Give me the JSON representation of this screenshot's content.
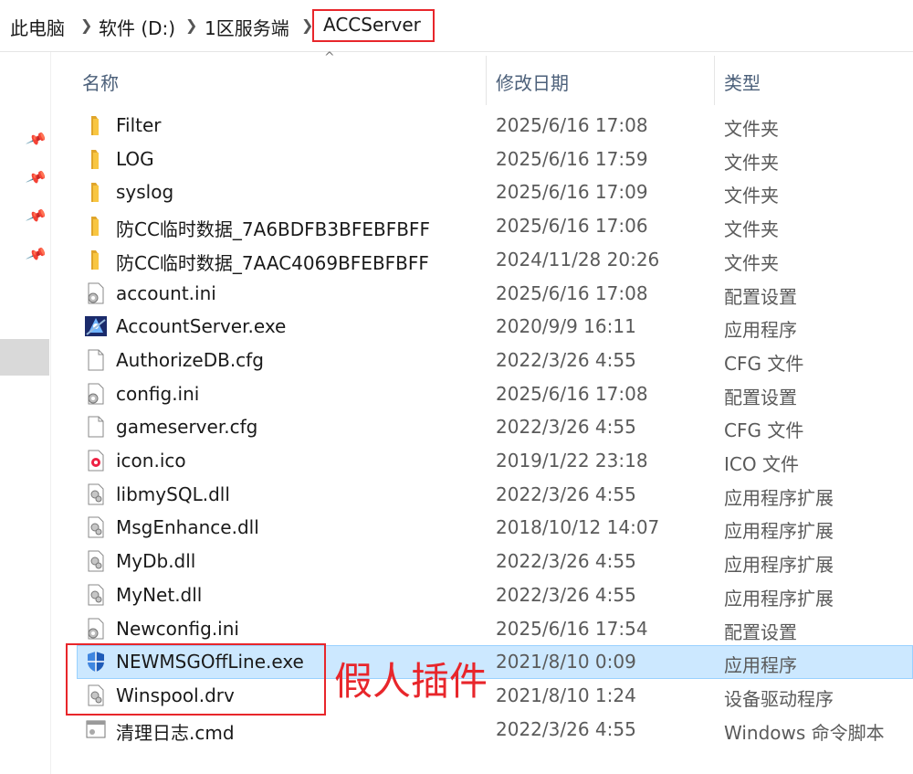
{
  "breadcrumb": {
    "items": [
      "此电脑",
      "软件 (D:)",
      "1区服务端",
      "ACCServer"
    ],
    "separator": ">"
  },
  "columns": {
    "sort_indicator": "^",
    "name": "名称",
    "date": "修改日期",
    "type": "类型"
  },
  "files": [
    {
      "name": "Filter",
      "date": "2025/6/16 17:08",
      "type": "文件夹",
      "icon": "folder-icon"
    },
    {
      "name": "LOG",
      "date": "2025/6/16 17:59",
      "type": "文件夹",
      "icon": "folder-icon"
    },
    {
      "name": "syslog",
      "date": "2025/6/16 17:09",
      "type": "文件夹",
      "icon": "folder-icon"
    },
    {
      "name": "防CC临时数据_7A6BDFB3BFEBFBFF",
      "date": "2025/6/16 17:06",
      "type": "文件夹",
      "icon": "folder-icon"
    },
    {
      "name": "防CC临时数据_7AAC4069BFEBFBFF",
      "date": "2024/11/28 20:26",
      "type": "文件夹",
      "icon": "folder-icon"
    },
    {
      "name": "account.ini",
      "date": "2025/6/16 17:08",
      "type": "配置设置",
      "icon": "ini-file-icon"
    },
    {
      "name": "AccountServer.exe",
      "date": "2020/9/9 16:11",
      "type": "应用程序",
      "icon": "exe-app-icon"
    },
    {
      "name": "AuthorizeDB.cfg",
      "date": "2022/3/26 4:55",
      "type": "CFG 文件",
      "icon": "blank-file-icon"
    },
    {
      "name": "config.ini",
      "date": "2025/6/16 17:08",
      "type": "配置设置",
      "icon": "ini-file-icon"
    },
    {
      "name": "gameserver.cfg",
      "date": "2022/3/26 4:55",
      "type": "CFG 文件",
      "icon": "blank-file-icon"
    },
    {
      "name": "icon.ico",
      "date": "2019/1/22 23:18",
      "type": "ICO 文件",
      "icon": "ico-file-icon"
    },
    {
      "name": "libmySQL.dll",
      "date": "2022/3/26 4:55",
      "type": "应用程序扩展",
      "icon": "dll-file-icon"
    },
    {
      "name": "MsgEnhance.dll",
      "date": "2018/10/12 14:07",
      "type": "应用程序扩展",
      "icon": "dll-file-icon"
    },
    {
      "name": "MyDb.dll",
      "date": "2022/3/26 4:55",
      "type": "应用程序扩展",
      "icon": "dll-file-icon"
    },
    {
      "name": "MyNet.dll",
      "date": "2022/3/26 4:55",
      "type": "应用程序扩展",
      "icon": "dll-file-icon"
    },
    {
      "name": "Newconfig.ini",
      "date": "2025/6/16 17:54",
      "type": "配置设置",
      "icon": "ini-file-icon"
    },
    {
      "name": "NEWMSGOffLine.exe",
      "date": "2021/8/10 0:09",
      "type": "应用程序",
      "icon": "shield-exe-icon",
      "selected": true
    },
    {
      "name": "Winspool.drv",
      "date": "2021/8/10 1:24",
      "type": "设备驱动程序",
      "icon": "dll-file-icon"
    },
    {
      "name": "清理日志.cmd",
      "date": "2022/3/26 4:55",
      "type": "Windows 命令脚本",
      "icon": "cmd-file-icon"
    }
  ],
  "annotation": {
    "label": "假人插件",
    "color": "#e8262b"
  },
  "colors": {
    "selection": "#cce8ff",
    "folder": "#f8c642",
    "header_text": "#4c607a"
  }
}
